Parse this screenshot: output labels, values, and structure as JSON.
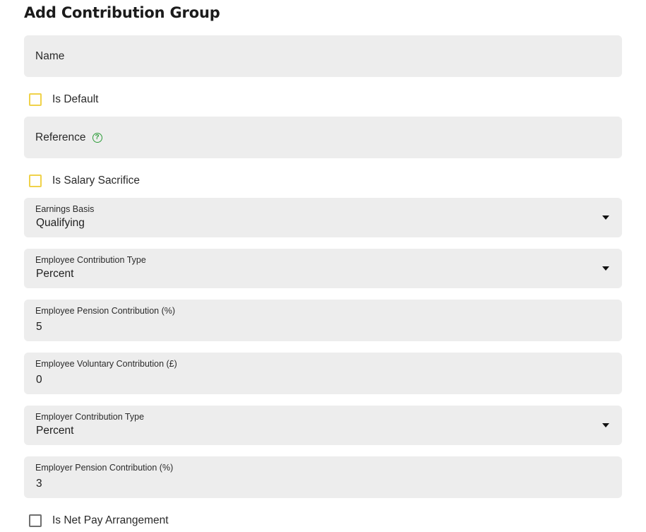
{
  "page": {
    "title": "Add Contribution Group"
  },
  "fields": {
    "name": {
      "placeholder": "Name"
    },
    "is_default": {
      "label": "Is Default",
      "checked": false
    },
    "reference": {
      "placeholder": "Reference",
      "help_icon": "help-circle-icon",
      "help_glyph": "?"
    },
    "is_salary_sacrifice": {
      "label": "Is Salary Sacrifice",
      "checked": false
    },
    "earnings_basis": {
      "label": "Earnings Basis",
      "value": "Qualifying"
    },
    "employee_contribution_type": {
      "label": "Employee Contribution Type",
      "value": "Percent"
    },
    "employee_pension_contribution": {
      "label": "Employee Pension Contribution (%)",
      "value": "5"
    },
    "employee_voluntary_contribution": {
      "label": "Employee Voluntary Contribution (£)",
      "value": "0"
    },
    "employer_contribution_type": {
      "label": "Employer Contribution Type",
      "value": "Percent"
    },
    "employer_pension_contribution": {
      "label": "Employer Pension Contribution (%)",
      "value": "3"
    },
    "is_net_pay_arrangement": {
      "label": "Is Net Pay Arrangement",
      "checked": false
    }
  },
  "colors": {
    "field_background": "#ededed",
    "checkbox_border_highlight": "#f0d24a",
    "checkbox_border_default": "#6f6f6f",
    "help_icon": "#2e9d3a"
  }
}
